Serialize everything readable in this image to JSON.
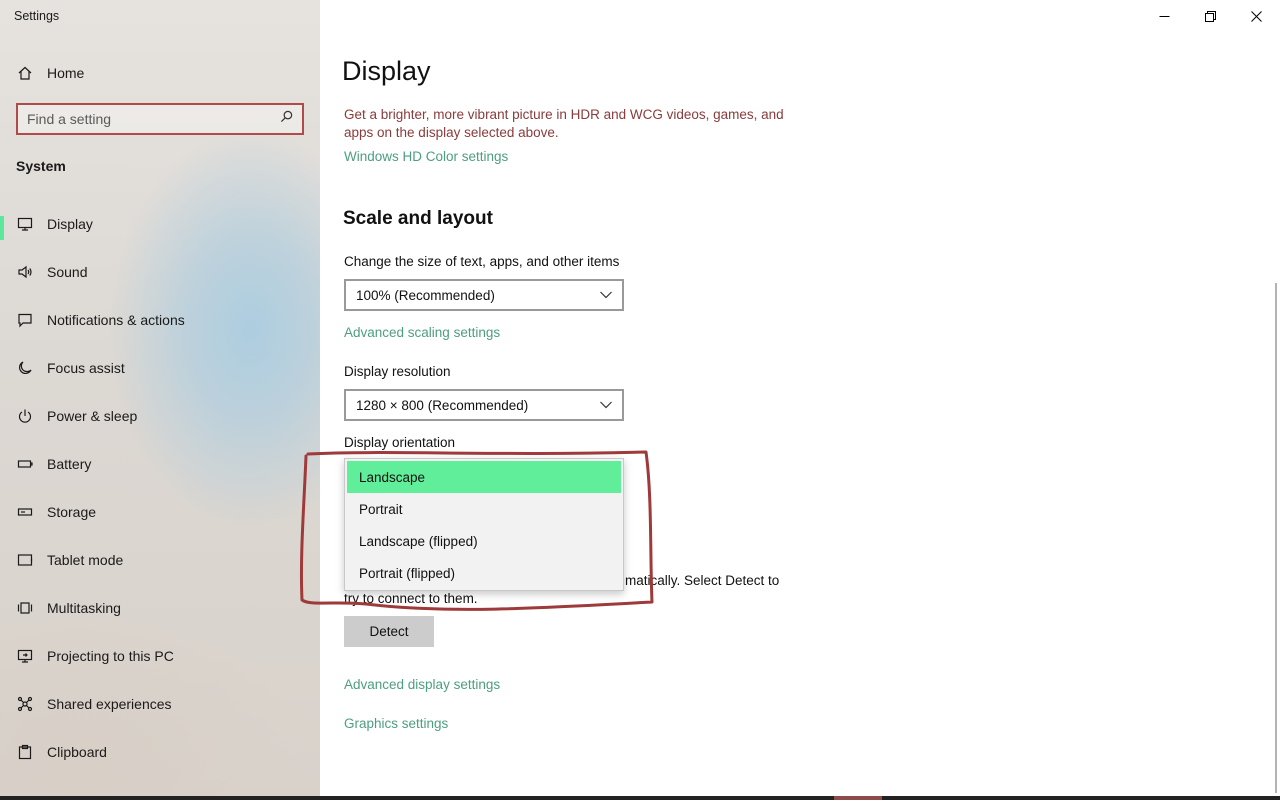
{
  "window": {
    "title": "Settings",
    "controls": [
      "minimize",
      "maximize",
      "close"
    ]
  },
  "sidebar": {
    "home_label": "Home",
    "search_placeholder": "Find a setting",
    "section_title": "System",
    "items": [
      {
        "label": "Display",
        "icon": "monitor-icon",
        "selected": true
      },
      {
        "label": "Sound",
        "icon": "speaker-icon"
      },
      {
        "label": "Notifications & actions",
        "icon": "notification-icon"
      },
      {
        "label": "Focus assist",
        "icon": "moon-icon"
      },
      {
        "label": "Power & sleep",
        "icon": "power-icon"
      },
      {
        "label": "Battery",
        "icon": "battery-icon"
      },
      {
        "label": "Storage",
        "icon": "storage-icon"
      },
      {
        "label": "Tablet mode",
        "icon": "tablet-icon"
      },
      {
        "label": "Multitasking",
        "icon": "multitasking-icon"
      },
      {
        "label": "Projecting to this PC",
        "icon": "projecting-icon"
      },
      {
        "label": "Shared experiences",
        "icon": "shared-icon"
      },
      {
        "label": "Clipboard",
        "icon": "clipboard-icon"
      }
    ]
  },
  "main": {
    "title": "Display",
    "hdr_description": "Get a brighter, more vibrant picture in HDR and WCG videos, games, and apps on the display selected above.",
    "hdr_link": "Windows HD Color settings",
    "scale_heading": "Scale and layout",
    "scale_label": "Change the size of text, apps, and other items",
    "scale_value": "100% (Recommended)",
    "advanced_scaling_link": "Advanced scaling settings",
    "resolution_label": "Display resolution",
    "resolution_value": "1280 × 800 (Recommended)",
    "orientation_label": "Display orientation",
    "orientation_options": [
      "Landscape",
      "Portrait",
      "Landscape (flipped)",
      "Portrait (flipped)"
    ],
    "orientation_selected": "Landscape",
    "detect_text_line1_visible": "matically. Select Detect to",
    "detect_text_line2_visible": "try to connect to them.",
    "detect_button": "Detect",
    "advanced_display_link": "Advanced display settings",
    "graphics_link": "Graphics settings"
  },
  "colors": {
    "accent": "#61ee9b",
    "link": "#2f8d6a",
    "annotation": "#9e3a3a"
  }
}
